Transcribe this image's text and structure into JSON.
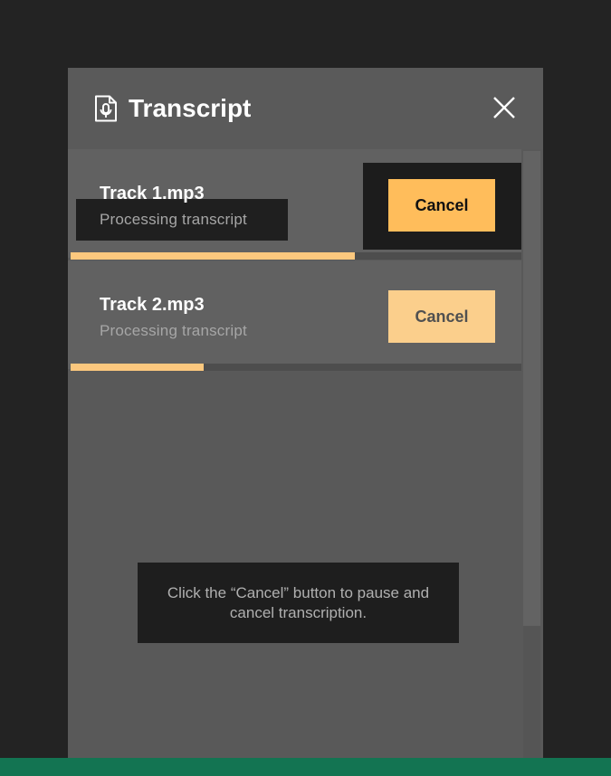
{
  "header": {
    "title": "Transcript",
    "icon": "transcript-mic-document-icon",
    "close_icon": "close-icon"
  },
  "items": [
    {
      "file_name": "Track 1.mp3",
      "status": "Processing transcript",
      "cancel_label": "Cancel",
      "progress": 0.63
    },
    {
      "file_name": "Track 2.mp3",
      "status": "Processing transcript",
      "cancel_label": "Cancel",
      "progress": 0.295
    }
  ],
  "tooltip": {
    "text": "Click the “Cancel” button to pause and cancel transcription."
  },
  "colors": {
    "accent": "#ffbd5b",
    "progress": "#fcc87e",
    "panel": "#5a5a5a",
    "background": "#232323",
    "bottom_bar": "#137452"
  }
}
